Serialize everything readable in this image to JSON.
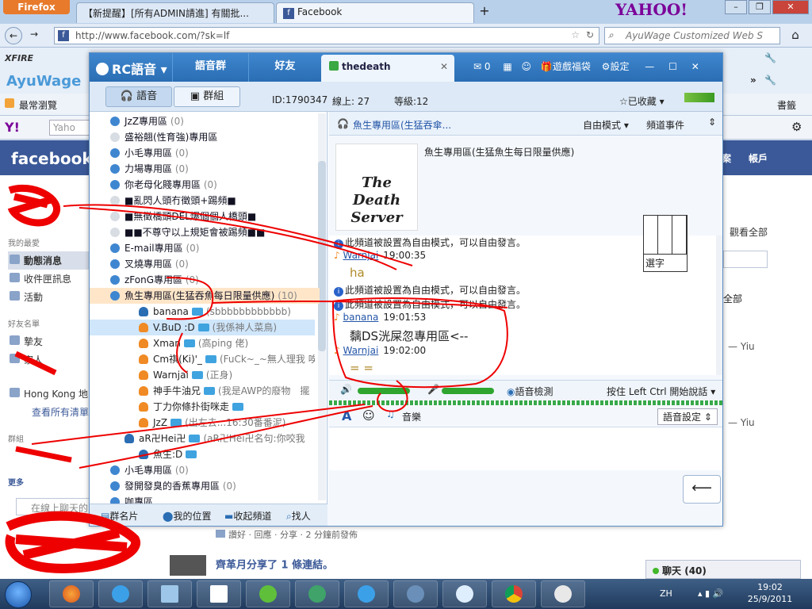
{
  "browser": {
    "menu_button": "Firefox",
    "tabs": [
      {
        "label": "【新提醒】[所有ADMIN請進] 有關批..."
      },
      {
        "label": "Facebook"
      }
    ],
    "new_tab": "+",
    "yahoo_logo": "YAHOO!",
    "url": "http://www.facebook.com/?sk=lf",
    "search_placeholder": "AyuWage Customized Web S",
    "toolbar_text": "AyuWage",
    "xfire": "XFIRE",
    "bookmarks_label": "最常瀏覽",
    "bookmarks_right": "書籤",
    "yahoo_small": "Y!",
    "yahoo_search": "Yaho"
  },
  "facebook": {
    "logo": "facebook",
    "header_right_1": "案",
    "header_right_2": "帳戶",
    "section_my": "我的最愛",
    "items": [
      {
        "label": "動態消息"
      },
      {
        "label": "收件匣訊息"
      },
      {
        "label": "活動"
      }
    ],
    "section_friends": "好友名單",
    "friend_items": [
      {
        "label": "摯友"
      },
      {
        "label": "家人"
      }
    ],
    "hong_kong": "Hong Kong 地",
    "view_all_lists": "查看所有清單",
    "section_groups": "群組",
    "more": "更多",
    "chat_search": "在線上聊天的",
    "see_all": "觀看全部",
    "all_partial": "全部",
    "yiu_1": "— Yiu",
    "yiu_2": "— Yiu",
    "feed_actions": "讚好 · 回應 · 分享 · 2 分鐘前發佈",
    "share_line": "齊革月分享了 1 條連結。",
    "chat_label": "聊天",
    "chat_count": "(40)"
  },
  "rc": {
    "logo": "RC語音",
    "nav": [
      {
        "label": "語音群"
      },
      {
        "label": "好友"
      }
    ],
    "active_tab": "thedeath",
    "mail_count": "0",
    "game_benefits": "遊戲福袋",
    "settings": "設定",
    "subtabs": [
      {
        "label": "語音"
      },
      {
        "label": "群組"
      }
    ],
    "id": "ID:1790347",
    "online": "線上: 27",
    "level": "等級:12",
    "favorited": "已收藏",
    "channels": [
      {
        "label": "JzZ專用區",
        "count": "(0)",
        "sub": false
      },
      {
        "label": "盛裕翹(性育強)專用區",
        "count": "",
        "sub": true
      },
      {
        "label": "小毛專用區",
        "count": "(0)",
        "sub": false
      },
      {
        "label": "力場專用區",
        "count": "(0)",
        "sub": false
      },
      {
        "label": "你老母化賤專用區",
        "count": "(0)",
        "sub": false
      },
      {
        "label": "■亂閃人頭冇徵頭+踢頻■",
        "count": "",
        "sub": true
      },
      {
        "label": "■無徵橋頭DEL爆個個人橋頭■",
        "count": "",
        "sub": true
      },
      {
        "label": "■■不尊守以上規矩會被踢頻■■",
        "count": "",
        "sub": true
      },
      {
        "label": "E-mail專用區",
        "count": "(0)",
        "sub": false
      },
      {
        "label": "叉燒專用區",
        "count": "(0)",
        "sub": false
      },
      {
        "label": "zFonG專用區",
        "count": "(0)",
        "sub": false
      },
      {
        "label": "魚生專用區(生猛吞魚每日限量供應)",
        "count": "(10)",
        "sub": false
      }
    ],
    "users": [
      {
        "name": "banana",
        "status": "(sbbbbbbbbbbbb)"
      },
      {
        "name": "V.BuD :D",
        "status": "(我係神人菜鳥)"
      },
      {
        "name": "Xman",
        "status": "(高ping 佬)"
      },
      {
        "name": "Cm祺(Ki)'_",
        "status": "(FuCk~_~無人理我 唉..."
      },
      {
        "name": "Warnjai",
        "status": "(正身)"
      },
      {
        "name": "神手牛油兄",
        "status": "(我是AWP的廢物　擺"
      },
      {
        "name": "丁力你條扑街咪走",
        "status": ""
      },
      {
        "name": "JzZ",
        "status": "(出左去...16:30番番泥)"
      },
      {
        "name": "aR卍Hei卍",
        "status": "(aR卍Hei卍名句:你咬我"
      },
      {
        "name": "魚生:D",
        "status": ""
      }
    ],
    "channels_after": [
      {
        "label": "小毛專用區",
        "count": "(0)"
      },
      {
        "label": "發開發臭的香蕉專用區",
        "count": "(0)"
      },
      {
        "label": "咖專區",
        "count": ""
      }
    ],
    "bottom": [
      {
        "label": "群名片"
      },
      {
        "label": "我的位置"
      },
      {
        "label": "收起頻道"
      },
      {
        "label": "找人"
      }
    ],
    "room_title": "魚生專用區(生猛吞傘...",
    "mode": "自由模式",
    "channel_events": "頻道事件",
    "banner": "The Death Server",
    "announcement": "魚生專用區(生猛魚生每日限量供應)",
    "chat": [
      {
        "type": "sys",
        "text": "此頻道被設置為自由模式，可以自由發言。"
      },
      {
        "type": "user",
        "name": "Warnjai",
        "time": "19:00:35"
      },
      {
        "type": "msg",
        "text": "ha"
      },
      {
        "type": "sys",
        "text": "此頻道被設置為自由模式，可以自由發言。"
      },
      {
        "type": "sys",
        "text": "此頻道被設置為自由模式，可以自由發言。"
      },
      {
        "type": "user",
        "name": "banana",
        "time": "19:01:53"
      },
      {
        "type": "msg",
        "text": "黐DS洸屎忽專用區<--"
      },
      {
        "type": "user",
        "name": "Warnjai",
        "time": "19:02:00"
      },
      {
        "type": "msg",
        "text": "= ="
      }
    ],
    "edit_pad_label": "選字",
    "voice_detect": "語音檢測",
    "push_to_talk": "按住 Left Ctrl 開始說話",
    "music": "音樂",
    "voice_settings": "語音設定",
    "send_glyph": "⟵",
    "colors": {
      "titlebar": "#2f77c0",
      "selected_channel": "#ffe6c8",
      "slider": "#2fa52f"
    }
  },
  "taskbar": {
    "language": "ZH",
    "time": "19:02",
    "date": "25/9/2011"
  }
}
